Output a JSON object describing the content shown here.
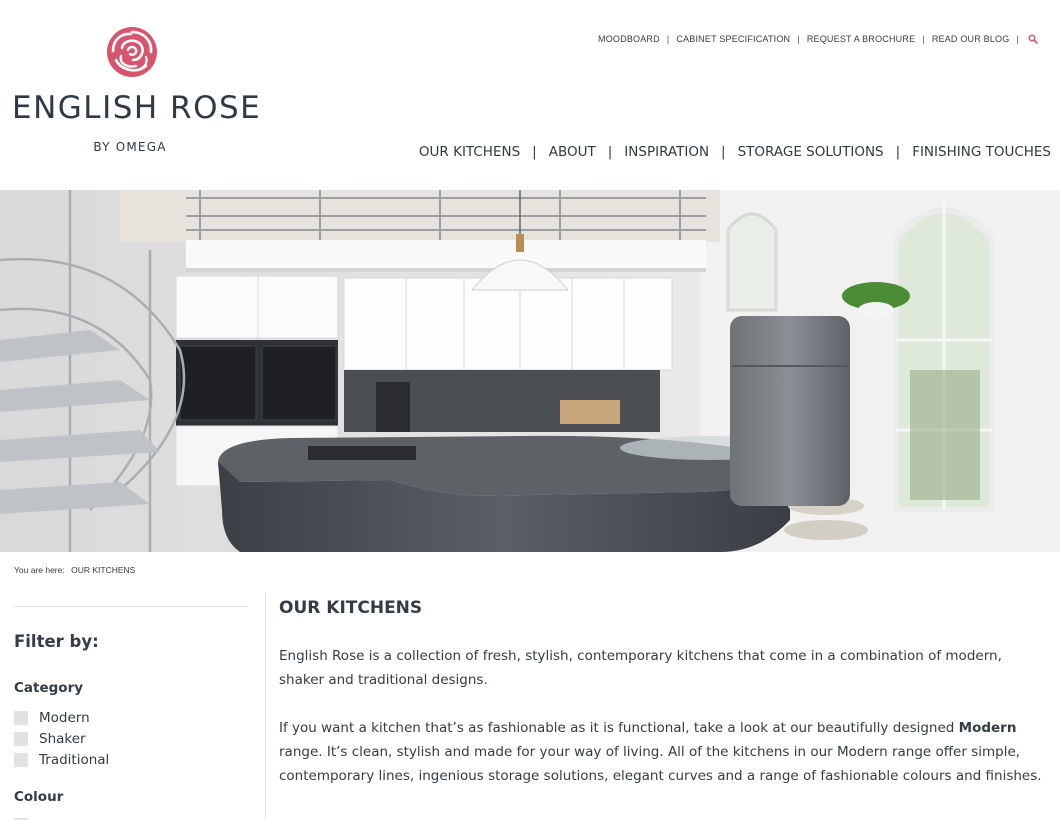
{
  "brand": {
    "name": "ENGLISH ROSE",
    "subtitle": "BY OMEGA",
    "accent_color": "#d9546d",
    "logo_icon": "rose-icon"
  },
  "utility_nav": {
    "items": [
      "MOODBOARD",
      "CABINET SPECIFICATION",
      "REQUEST A BROCHURE",
      "READ OUR BLOG"
    ],
    "search_icon": "search-icon"
  },
  "main_nav": {
    "items": [
      "OUR KITCHENS",
      "ABOUT",
      "INSPIRATION",
      "STORAGE SOLUTIONS",
      "FINISHING TOUCHES"
    ]
  },
  "breadcrumb": {
    "prefix": "You are here:",
    "current": "OUR KITCHENS"
  },
  "sidebar": {
    "filter_title": "Filter by:",
    "category": {
      "title": "Category",
      "options": [
        "Modern",
        "Shaker",
        "Traditional"
      ]
    },
    "colour": {
      "title": "Colour"
    }
  },
  "content": {
    "heading": "OUR KITCHENS",
    "paragraph1": "English Rose is a collection of fresh, stylish, contemporary kitchens that come in a combination of modern, shaker and traditional designs.",
    "paragraph2_before": "If you want a kitchen that’s as fashionable as it is functional, take a look at our beautifully designed ",
    "paragraph2_bold": "Modern",
    "paragraph2_after": " range. It’s clean, stylish and made for your way of living. All of the kitchens in our Modern range offer simple, contemporary lines, ingenious storage solutions, elegant curves and a range of fashionable colours and finishes."
  }
}
